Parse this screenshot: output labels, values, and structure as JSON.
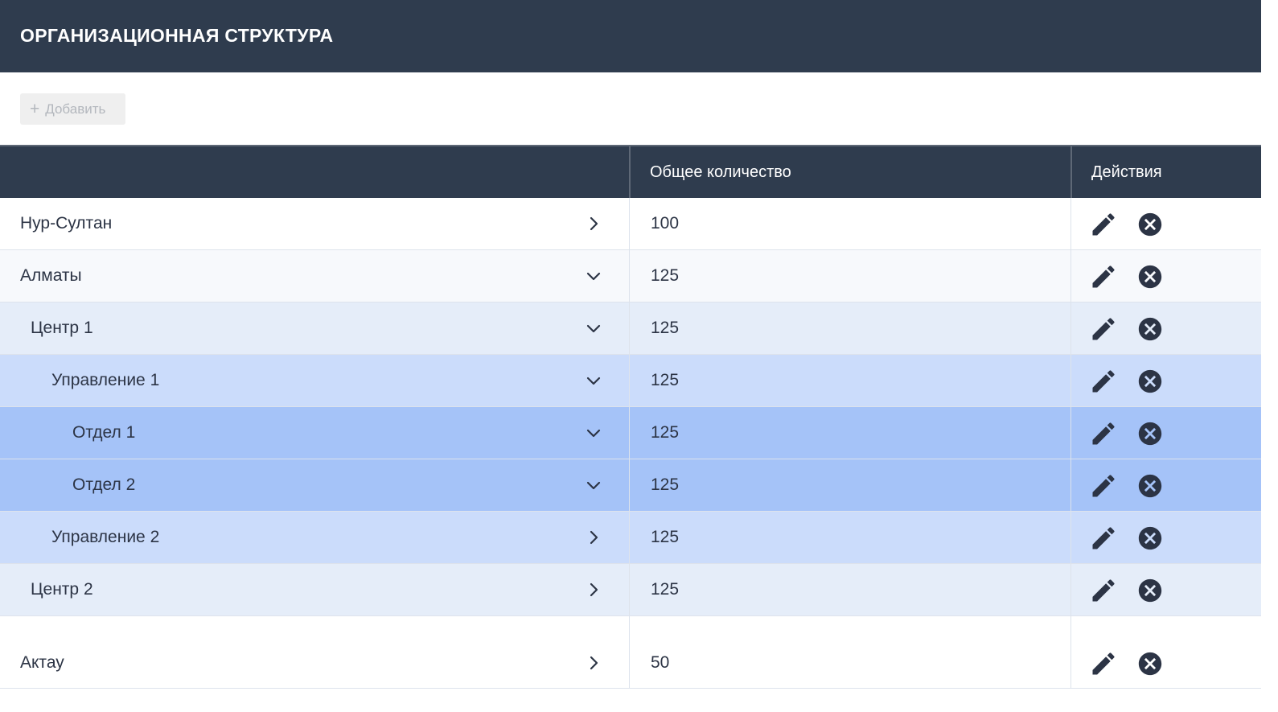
{
  "header": {
    "title": "ОРГАНИЗАЦИОННАЯ СТРУКТУРА"
  },
  "toolbar": {
    "add_icon": "+",
    "add_label": "Добавить"
  },
  "table": {
    "columns": {
      "name": "",
      "count": "Общее количество",
      "actions": "Действия"
    },
    "rows": [
      {
        "name": "Нур-Султан",
        "count": "100",
        "expanded": false,
        "level": 0
      },
      {
        "name": "Алматы",
        "count": "125",
        "expanded": true,
        "level": 0
      },
      {
        "name": "Центр 1",
        "count": "125",
        "expanded": true,
        "level": 1
      },
      {
        "name": "Управление 1",
        "count": "125",
        "expanded": true,
        "level": 2
      },
      {
        "name": "Отдел 1",
        "count": "125",
        "expanded": true,
        "level": 3
      },
      {
        "name": "Отдел 2",
        "count": "125",
        "expanded": true,
        "level": 3
      },
      {
        "name": "Управление 2",
        "count": "125",
        "expanded": false,
        "level": 2
      },
      {
        "name": "Центр 2",
        "count": "125",
        "expanded": false,
        "level": 1
      },
      {
        "name": "Актау",
        "count": "50",
        "expanded": false,
        "level": 0
      }
    ]
  },
  "icons": {
    "expand": "chevron-right-icon",
    "collapse": "chevron-down-icon",
    "edit": "pencil-icon",
    "delete": "close-circle-icon"
  },
  "colors": {
    "header_bg": "#2f3c4e",
    "level1_bg": "#e5edf9",
    "level2_bg": "#cbdcfb",
    "level3_bg": "#a5c3f8",
    "text": "#2c3445"
  }
}
